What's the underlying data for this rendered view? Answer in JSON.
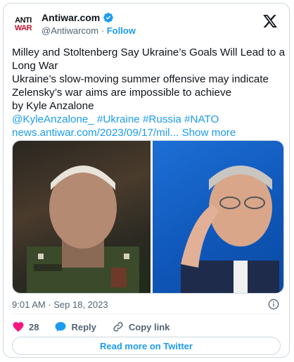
{
  "tweet": {
    "logo": {
      "line1": "ANTI",
      "line2": "WAR"
    },
    "author_name": "Antiwar.com",
    "handle": "@Antiwarcom",
    "dot": "·",
    "follow_label": "Follow",
    "lines": [
      "Milley and Stoltenberg Say Ukraine’s Goals Will Lead to a",
      "Long War",
      "Ukraine’s slow-moving summer offensive may indicate",
      "Zelensky’s war aims are impossible to achieve",
      "by Kyle Anzalone"
    ],
    "tags_line": "@KyleAnzalone_ #Ukraine #Russia #NATO",
    "url_text": "news.antiwar.com/2023/09/17/mil...",
    "show_more": "Show more",
    "timestamp": "9:01 AM · Sep 18, 2023",
    "like_count": "28",
    "reply_label": "Reply",
    "copy_link_label": "Copy link",
    "read_more_label": "Read more on Twitter"
  },
  "colors": {
    "accent": "#1d9bf0",
    "like": "#f91880",
    "secondary_text": "#536471"
  }
}
